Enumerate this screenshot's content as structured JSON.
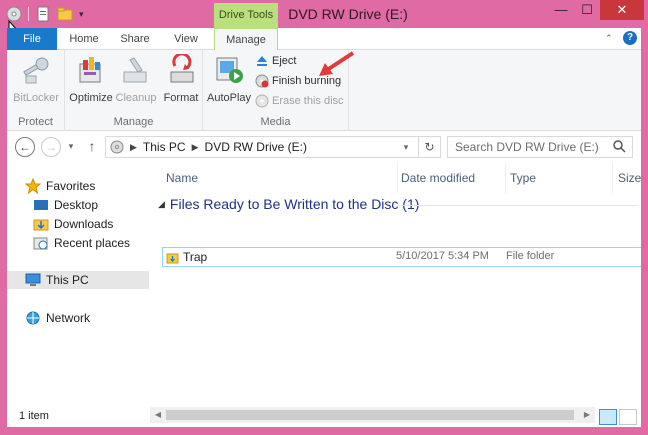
{
  "window": {
    "title": "DVD RW Drive (E:)",
    "context_tab_label": "Drive Tools",
    "controls": {
      "minimize": "—",
      "maximize": "☐",
      "close": "✕"
    },
    "accent_color": "#e06aa3"
  },
  "ribbon": {
    "tabs": {
      "file": "File",
      "home": "Home",
      "share": "Share",
      "view": "View",
      "manage": "Manage"
    },
    "groups": {
      "protect": {
        "label": "Protect",
        "bitlocker": "BitLocker"
      },
      "manage": {
        "label": "Manage",
        "optimize": "Optimize",
        "cleanup": "Cleanup",
        "format": "Format"
      },
      "media": {
        "label": "Media",
        "autoplay": "AutoPlay",
        "eject": "Eject",
        "finish_burning": "Finish burning",
        "erase": "Erase this disc"
      }
    }
  },
  "address": {
    "crumbs": [
      "This PC",
      "DVD RW Drive (E:)"
    ],
    "search_placeholder": "Search DVD RW Drive (E:)"
  },
  "nav": {
    "favorites": "Favorites",
    "desktop": "Desktop",
    "downloads": "Downloads",
    "recent": "Recent places",
    "this_pc": "This PC",
    "network": "Network"
  },
  "content": {
    "columns": {
      "name": "Name",
      "date": "Date modified",
      "type": "Type",
      "size": "Size"
    },
    "group_header": "Files Ready to Be Written to the Disc (1)",
    "rows": [
      {
        "name": "Trap",
        "date": "5/10/2017 5:34 PM",
        "type": "File folder"
      }
    ]
  },
  "status": {
    "item_count": "1 item"
  }
}
